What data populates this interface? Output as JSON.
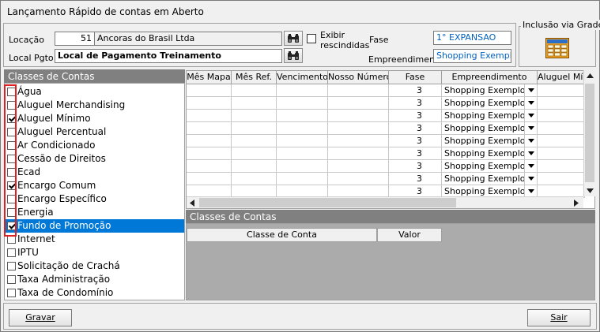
{
  "window": {
    "title": "Lançamento Rápido de contas em Aberto"
  },
  "header": {
    "locacao_label": "Locação",
    "locacao_code": "51",
    "locacao_name": "Ancoras do Brasil Ltda",
    "localpgto_label": "Local Pgto",
    "localpgto_value": "Local de Pagamento Treinamento",
    "exibir_label_1": "Exibir",
    "exibir_label_2": "rescindidas",
    "fase_label": "Fase",
    "fase_value": "1° EXPANSAO",
    "empreendimento_label": "Empreendimento",
    "empreendimento_value": "Shopping Exemplo"
  },
  "inclusao": {
    "title": "Inclusão via Grade"
  },
  "classes_panel": {
    "title": "Classes de Contas",
    "items": [
      {
        "label": "Água",
        "checked": false
      },
      {
        "label": "Aluguel Merchandising",
        "checked": false
      },
      {
        "label": "Aluguel Mínimo",
        "checked": true
      },
      {
        "label": "Aluguel Percentual",
        "checked": false
      },
      {
        "label": "Ar Condicionado",
        "checked": false
      },
      {
        "label": "Cessão de Direitos",
        "checked": false
      },
      {
        "label": "Ecad",
        "checked": false
      },
      {
        "label": "Encargo Comum",
        "checked": true
      },
      {
        "label": "Encargo Específico",
        "checked": false
      },
      {
        "label": "Energia",
        "checked": false
      },
      {
        "label": "Fundo de Promoção",
        "checked": true,
        "selected": true
      },
      {
        "label": "Internet",
        "checked": false
      },
      {
        "label": "IPTU",
        "checked": false
      },
      {
        "label": "Solicitação de Crachá",
        "checked": false
      },
      {
        "label": "Taxa Administração",
        "checked": false
      },
      {
        "label": "Taxa de Condomínio",
        "checked": false
      }
    ]
  },
  "grid": {
    "columns": [
      "Mês Mapa",
      "Mês Ref.",
      "Vencimento",
      "Nosso Número",
      "Fase",
      "Empreendimento",
      "Aluguel Mín"
    ],
    "rows": [
      {
        "fase": "3",
        "empreendimento": "Shopping Exemplo"
      },
      {
        "fase": "3",
        "empreendimento": "Shopping Exemplo"
      },
      {
        "fase": "3",
        "empreendimento": "Shopping Exemplo"
      },
      {
        "fase": "3",
        "empreendimento": "Shopping Exemplo"
      },
      {
        "fase": "3",
        "empreendimento": "Shopping Exemplo"
      },
      {
        "fase": "3",
        "empreendimento": "Shopping Exemplo"
      },
      {
        "fase": "3",
        "empreendimento": "Shopping Exemplo"
      },
      {
        "fase": "3",
        "empreendimento": "Shopping Exemplo"
      },
      {
        "fase": "3",
        "empreendimento": "Shopping Exemplo"
      }
    ]
  },
  "lower": {
    "title": "Classes de Contas",
    "columns": [
      "Classe de Conta",
      "Valor"
    ]
  },
  "footer": {
    "gravar": "Gravar",
    "sair": "Sair"
  },
  "colors": {
    "selection": "#0078d7",
    "highlight_box": "#e02020",
    "section_header": "#808080"
  }
}
